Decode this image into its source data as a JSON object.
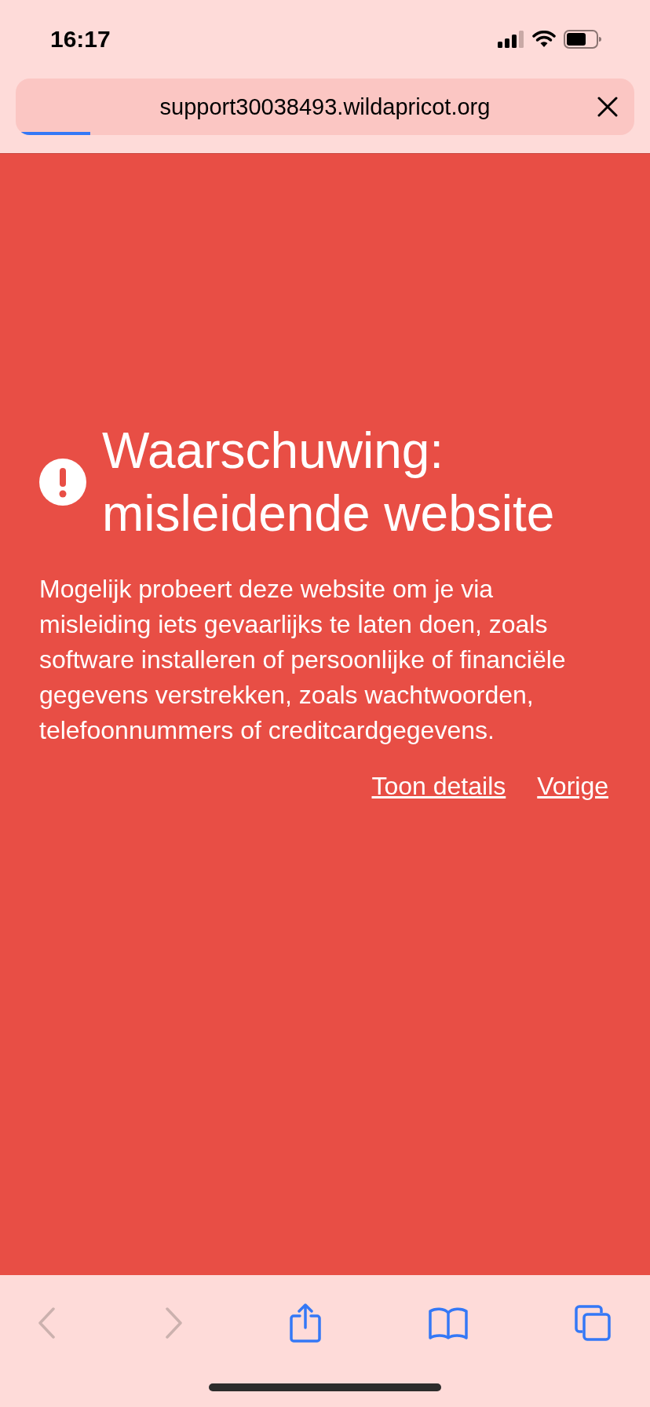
{
  "status_bar": {
    "time": "16:17"
  },
  "address_bar": {
    "url": "support30038493.wildapricot.org",
    "loading": {
      "level": 0.12
    }
  },
  "warning": {
    "title": "Waarschuwing: misleidende website",
    "message": "Mogelijk probeert deze website om je via misleiding iets gevaarlijks te laten doen, zoals software installeren of persoonlijke of financiële gegevens verstrekken, zoals wachtwoorden, telefoonnummers of creditcardgegevens.",
    "links": [
      "Toon details",
      "Vorige"
    ]
  },
  "toolbar": {
    "buttons": [
      {
        "kind": "back",
        "disabled": true
      },
      {
        "kind": "forward",
        "disabled": true
      },
      {
        "kind": "share",
        "disabled": false
      },
      {
        "kind": "bookmarks",
        "disabled": false
      },
      {
        "kind": "tabs",
        "disabled": false
      }
    ]
  }
}
